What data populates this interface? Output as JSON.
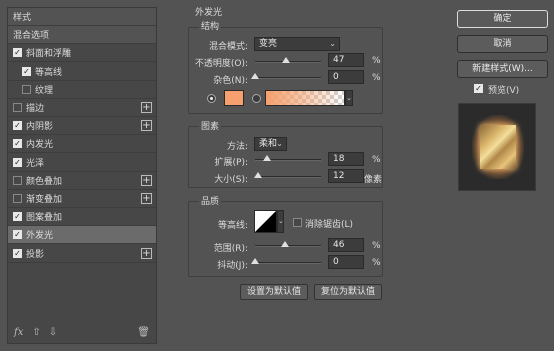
{
  "left_panel": {
    "items": [
      {
        "label": "样式",
        "type": "header"
      },
      {
        "label": "混合选项",
        "type": "header"
      },
      {
        "label": "斜面和浮雕",
        "checked": true,
        "plus": false
      },
      {
        "label": "等高线",
        "checked": true,
        "plus": false,
        "indent": true
      },
      {
        "label": "纹理",
        "checked": false,
        "plus": false,
        "indent": true
      },
      {
        "label": "描边",
        "checked": false,
        "plus": true
      },
      {
        "label": "内阴影",
        "checked": true,
        "plus": true
      },
      {
        "label": "内发光",
        "checked": true,
        "plus": false
      },
      {
        "label": "光泽",
        "checked": true,
        "plus": false
      },
      {
        "label": "颜色叠加",
        "checked": false,
        "plus": true
      },
      {
        "label": "渐变叠加",
        "checked": false,
        "plus": true
      },
      {
        "label": "图案叠加",
        "checked": true,
        "plus": false
      },
      {
        "label": "外发光",
        "checked": true,
        "plus": false,
        "selected": true
      },
      {
        "label": "投影",
        "checked": true,
        "plus": true
      }
    ],
    "footer": {
      "fx": "fx",
      "up": "⇧",
      "down": "⇩",
      "trash": "🗑"
    }
  },
  "main": {
    "title": "外发光",
    "structure": {
      "title": "结构",
      "blend_mode_label": "混合模式:",
      "blend_mode_value": "变亮",
      "opacity_label": "不透明度(O):",
      "opacity_value": "47",
      "opacity_unit": "%",
      "opacity_level": 0.47,
      "noise_label": "杂色(N):",
      "noise_value": "0",
      "noise_unit": "%",
      "noise_level": 0.0,
      "color_swatch": "#f5a06e"
    },
    "elements": {
      "title": "图素",
      "method_label": "方法:",
      "method_value": "柔和",
      "spread_label": "扩展(P):",
      "spread_value": "18",
      "spread_unit": "%",
      "spread_level": 0.18,
      "size_label": "大小(S):",
      "size_value": "12",
      "size_unit": "像素",
      "size_level": 0.05
    },
    "quality": {
      "title": "品质",
      "contour_label": "等高线:",
      "antialias_label": "消除锯齿(L)",
      "range_label": "范围(R):",
      "range_value": "46",
      "range_unit": "%",
      "range_level": 0.46,
      "jitter_label": "抖动(J):",
      "jitter_value": "0",
      "jitter_unit": "%",
      "jitter_level": 0.0
    },
    "buttons": {
      "set_default": "设置为默认值",
      "reset_default": "复位为默认值"
    }
  },
  "right_panel": {
    "ok": "确定",
    "cancel": "取消",
    "new_style": "新建样式(W)...",
    "preview_label": "预览(V)",
    "preview_checked": true
  }
}
